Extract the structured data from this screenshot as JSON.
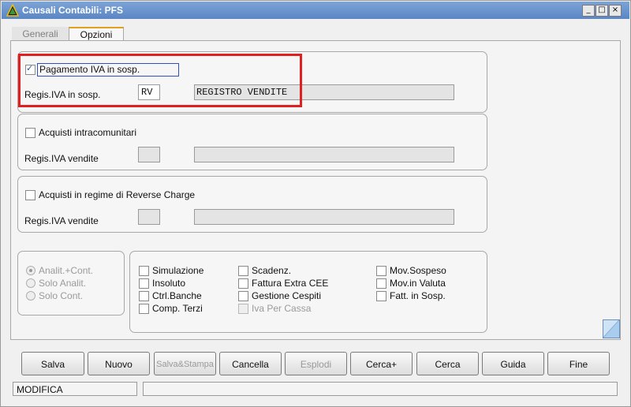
{
  "window": {
    "title": "Causali Contabili: PFS",
    "minimize": "_",
    "restore": "□",
    "close": "×"
  },
  "tabs": [
    {
      "label": "Generali",
      "active": false
    },
    {
      "label": "Opzioni",
      "active": true
    }
  ],
  "group1": {
    "checkbox_label": "Pagamento IVA in sosp.",
    "checked": true,
    "field_label": "Regis.IVA in sosp.",
    "code_value": "RV",
    "desc_value": "REGISTRO VENDITE"
  },
  "group2": {
    "checkbox_label": "Acquisti intracomunitari",
    "checked": false,
    "field_label": "Regis.IVA vendite",
    "code_value": "",
    "desc_value": ""
  },
  "group3": {
    "checkbox_label": "Acquisti in regime di Reverse Charge",
    "checked": false,
    "field_label": "Regis.IVA vendite",
    "code_value": "",
    "desc_value": ""
  },
  "radios": [
    {
      "label": "Analit.+Cont.",
      "selected": true
    },
    {
      "label": "Solo Analit.",
      "selected": false
    },
    {
      "label": "Solo Cont.",
      "selected": false
    }
  ],
  "options": {
    "col1": [
      "Simulazione",
      "Insoluto",
      "Ctrl.Banche",
      "Comp. Terzi"
    ],
    "col2": [
      "Scadenz.",
      "Fattura Extra CEE",
      "Gestione Cespiti",
      "Iva Per Cassa"
    ],
    "col3": [
      "Mov.Sospeso",
      "Mov.in Valuta",
      "Fatt. in Sosp."
    ]
  },
  "buttons": {
    "salva": "Salva",
    "nuovo": "Nuovo",
    "salva_stampa": "Salva&Stampa",
    "cancella": "Cancella",
    "esplodi": "Esplodi",
    "cerca_plus": "Cerca+",
    "cerca": "Cerca",
    "guida": "Guida",
    "fine": "Fine"
  },
  "status": {
    "mode": "MODIFICA",
    "message": ""
  },
  "colors": {
    "titlebar": "#6b96cf",
    "highlight": "#e02020",
    "active_tab_accent": "#e0a020"
  }
}
